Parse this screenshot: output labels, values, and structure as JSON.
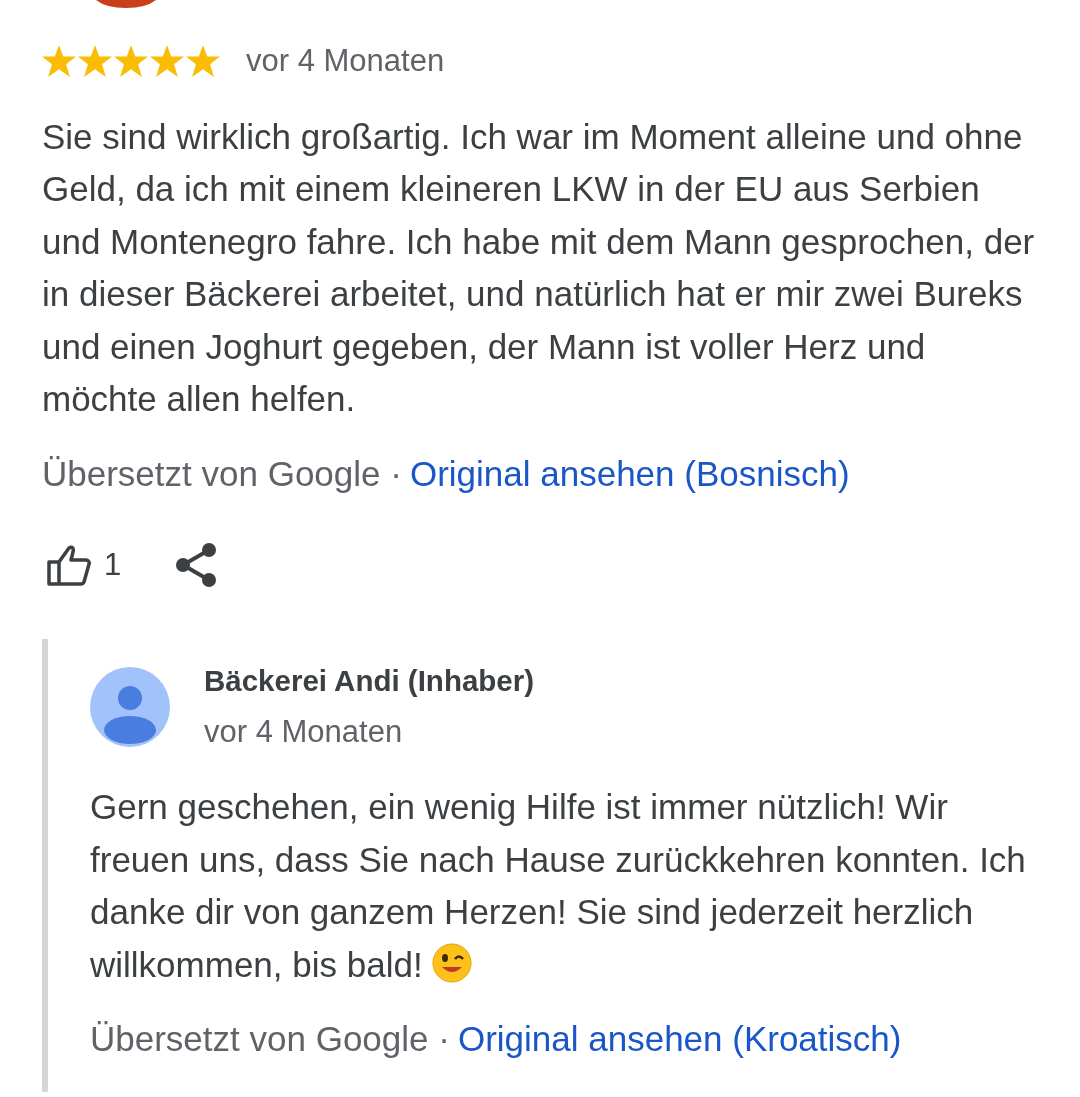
{
  "review": {
    "stars": 5,
    "time": "vor 4 Monaten",
    "text": "Sie sind wirklich großartig. Ich war im Moment alleine und ohne Geld, da ich mit einem kleineren LKW in der EU aus Serbien und Montenegro fahre. Ich habe mit dem Mann gesprochen, der in dieser Bäckerei arbeitet, und natürlich hat er mir zwei Bureks und einen Joghurt gegeben, der Mann ist voller Herz und möchte allen helfen.",
    "translated_by": "Übersetzt von Google ·",
    "original_link": "Original ansehen (Bosnisch)",
    "likes": "1"
  },
  "owner_reply": {
    "name": "Bäckerei Andi (Inhaber)",
    "time": "vor 4 Monaten",
    "text": "Gern geschehen, ein wenig Hilfe ist immer nützlich! Wir freuen uns, dass Sie nach Hause zurückkehren konnten. Ich danke dir von ganzem Herzen! Sie sind jederzeit herzlich willkommen, bis bald!",
    "translated_by": "Übersetzt von Google ·",
    "original_link": "Original ansehen (Kroatisch)"
  }
}
